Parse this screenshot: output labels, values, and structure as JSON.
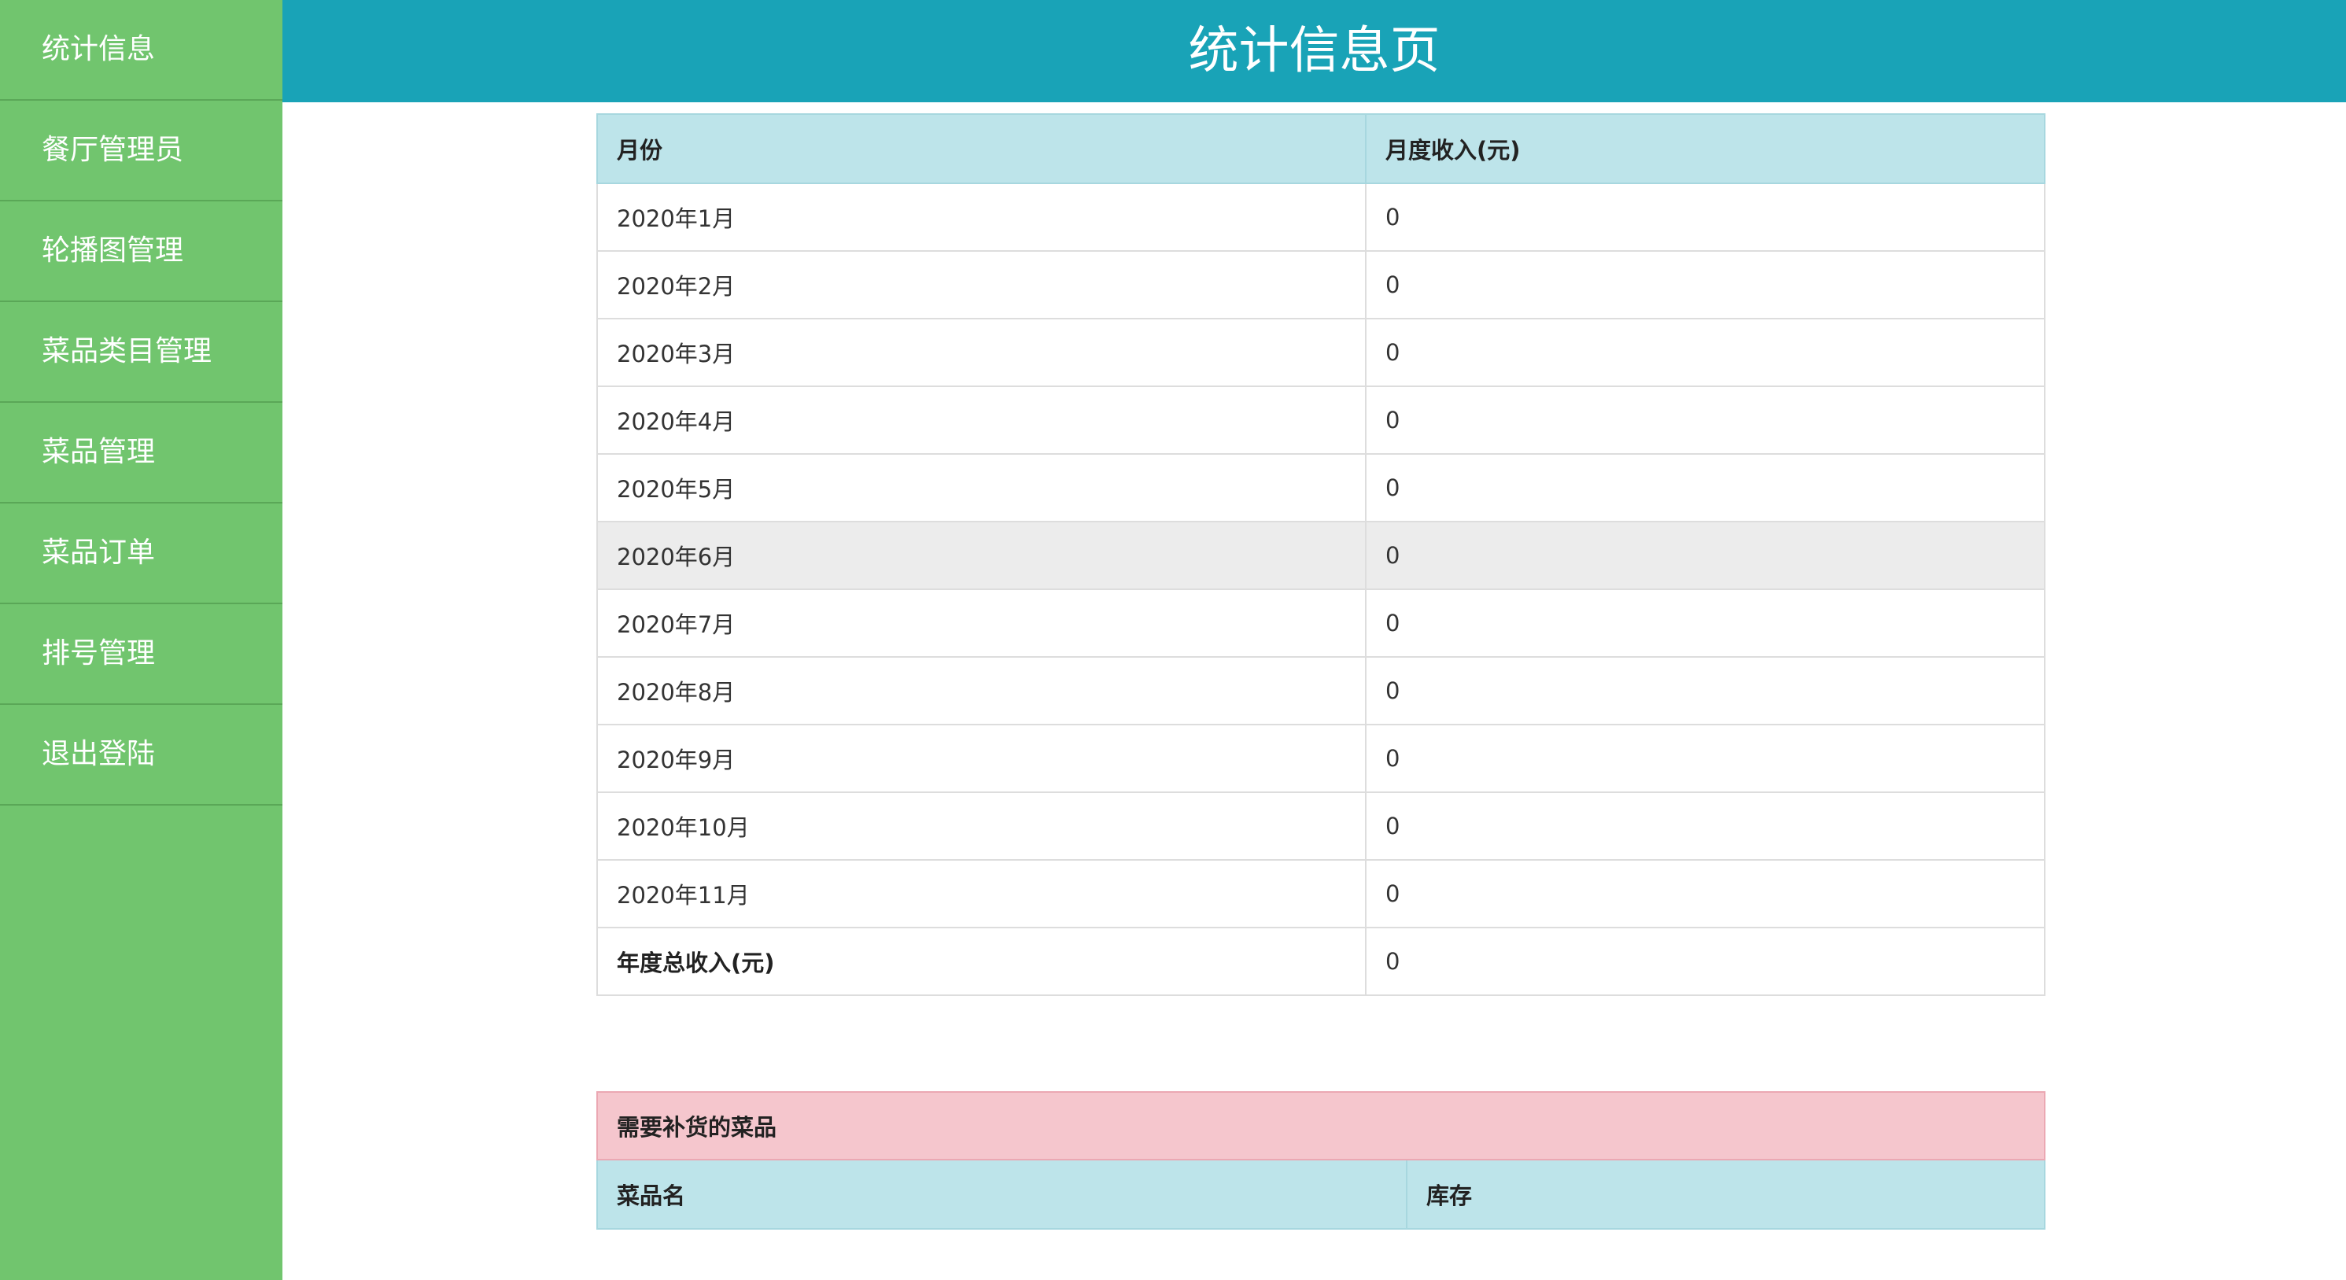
{
  "sidebar": {
    "items": [
      {
        "label": "统计信息"
      },
      {
        "label": "餐厅管理员"
      },
      {
        "label": "轮播图管理"
      },
      {
        "label": "菜品类目管理"
      },
      {
        "label": "菜品管理"
      },
      {
        "label": "菜品订单"
      },
      {
        "label": "排号管理"
      },
      {
        "label": "退出登陆"
      }
    ]
  },
  "header": {
    "title": "统计信息页"
  },
  "stats_table": {
    "headers": {
      "month": "月份",
      "income": "月度收入(元)"
    },
    "rows": [
      {
        "month": "2020年1月",
        "income": "0"
      },
      {
        "month": "2020年2月",
        "income": "0"
      },
      {
        "month": "2020年3月",
        "income": "0"
      },
      {
        "month": "2020年4月",
        "income": "0"
      },
      {
        "month": "2020年5月",
        "income": "0"
      },
      {
        "month": "2020年6月",
        "income": "0"
      },
      {
        "month": "2020年7月",
        "income": "0"
      },
      {
        "month": "2020年8月",
        "income": "0"
      },
      {
        "month": "2020年9月",
        "income": "0"
      },
      {
        "month": "2020年10月",
        "income": "0"
      },
      {
        "month": "2020年11月",
        "income": "0"
      }
    ],
    "total": {
      "label": "年度总收入(元)",
      "value": "0"
    }
  },
  "restock_table": {
    "title": "需要补货的菜品",
    "headers": {
      "name": "菜品名",
      "stock": "库存"
    }
  },
  "colors": {
    "sidebar_bg": "#71c56e",
    "header_bg": "#19a3b7",
    "table_header_bg": "#bde4ea",
    "restock_title_bg": "#f5c6cd",
    "highlight_row_bg": "#ececec"
  }
}
